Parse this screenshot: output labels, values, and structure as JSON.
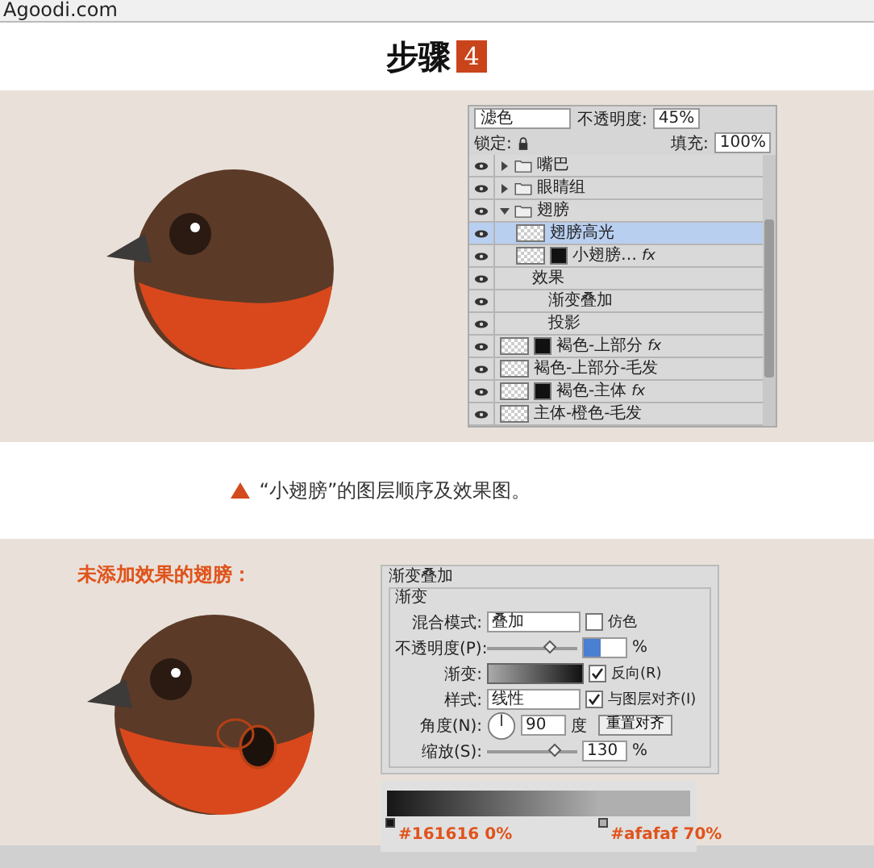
{
  "top_bar": {
    "site": "Agoodi.com"
  },
  "heading": {
    "title": "步骤",
    "step": "4"
  },
  "layers_panel": {
    "blend_mode": "滤色",
    "opacity_label": "不透明度:",
    "opacity": "45%",
    "lock_label": "锁定:",
    "fill_label": "填充:",
    "fill": "100%",
    "layers": [
      {
        "kind": "folder",
        "name": "嘴巴",
        "expanded": false,
        "selected": false
      },
      {
        "kind": "folder",
        "name": "眼睛组",
        "expanded": false,
        "selected": false
      },
      {
        "kind": "folder",
        "name": "翅膀",
        "expanded": true,
        "selected": false,
        "children": [
          {
            "kind": "layer",
            "name": "翅膀高光",
            "mask": false,
            "selected": true
          },
          {
            "kind": "layer",
            "name": "小翅膀…",
            "mask": true,
            "fx": "fx",
            "selected": false,
            "children": [
              {
                "kind": "effects",
                "name": "效果",
                "selected": false,
                "children": [
                  {
                    "kind": "effect",
                    "name": "渐变叠加",
                    "selected": false
                  },
                  {
                    "kind": "effect",
                    "name": "投影",
                    "selected": false
                  }
                ]
              }
            ]
          }
        ]
      },
      {
        "kind": "layer",
        "name": "褐色-上部分",
        "mask": true,
        "fx": "fx",
        "selected": false
      },
      {
        "kind": "layer",
        "name": "褐色-上部分-毛发",
        "mask": false,
        "selected": false
      },
      {
        "kind": "layer",
        "name": "褐色-主体",
        "mask": true,
        "fx": "fx",
        "selected": false
      },
      {
        "kind": "layer",
        "name": "主体-橙色-毛发",
        "mask": false,
        "selected": false
      }
    ]
  },
  "caption": "“小翅膀”的图层顺序及效果图。",
  "section_label": "未添加效果的翅膀：",
  "gradient_overlay": {
    "title": "渐变叠加",
    "group": "渐变",
    "blend_label": "混合模式:",
    "blend_mode": "叠加",
    "dither": {
      "label": "仿色",
      "checked": false
    },
    "opacity_label": "不透明度(P):",
    "opacity_slider": {
      "level": 0.7
    },
    "opacity_unit": "%",
    "gradient_label": "渐变:",
    "reverse": {
      "label": "反向(R)",
      "checked": true
    },
    "style_label": "样式:",
    "style": "线性",
    "align": {
      "label": "与图层对齐(I)",
      "checked": true
    },
    "angle_label": "角度(N):",
    "angle": "90",
    "angle_unit": "度",
    "reset_button": "重置对齐",
    "scale_label": "缩放(S):",
    "scale_slider": {
      "level": 0.75
    },
    "scale": "130",
    "scale_unit": "%"
  },
  "gradient_stops": [
    {
      "label": "#161616 0%",
      "color": "#161616",
      "level": 0
    },
    {
      "label": "#afafaf 70%",
      "color": "#afafaf",
      "level": 0.7
    }
  ]
}
